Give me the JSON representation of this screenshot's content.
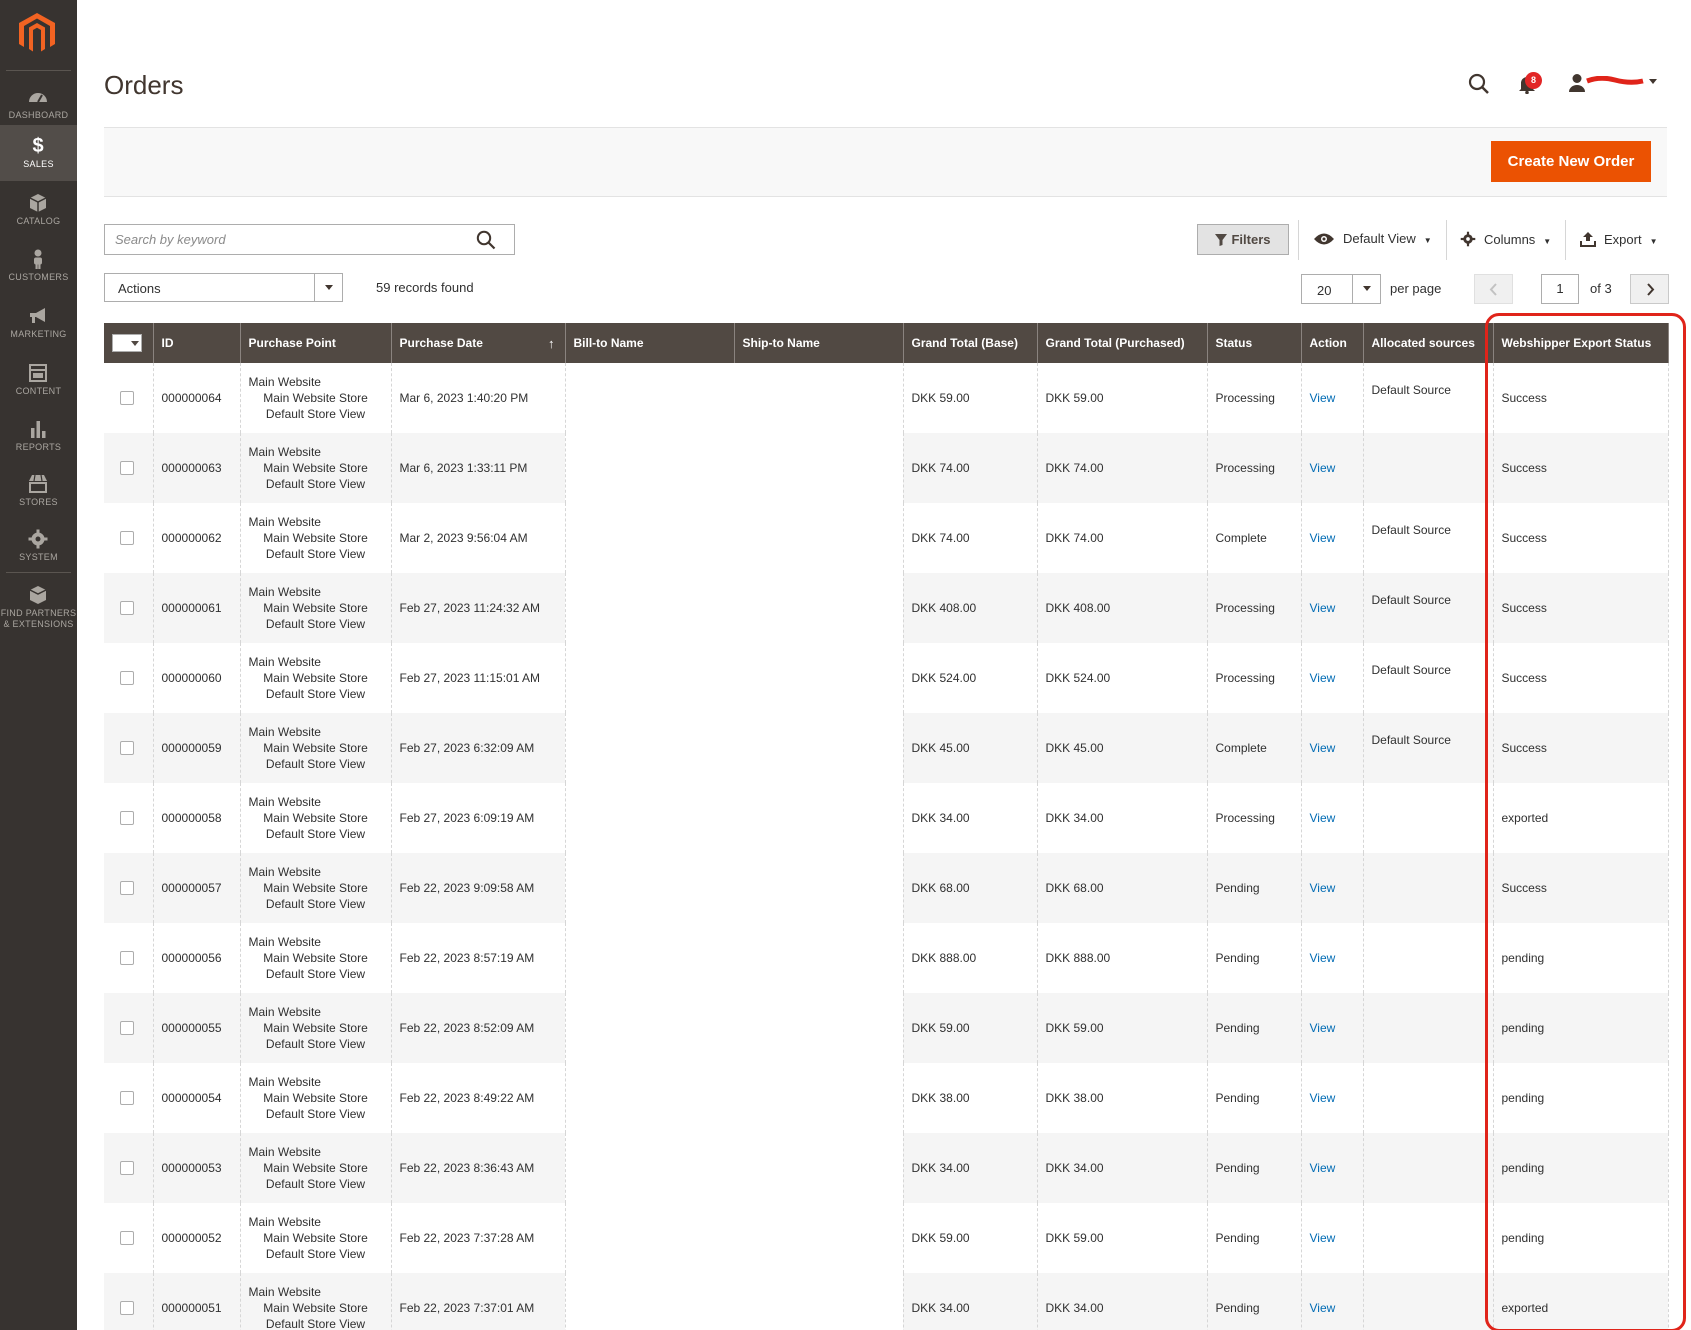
{
  "sidebar": {
    "items": [
      {
        "label": "DASHBOARD",
        "icon": "dashboard-icon"
      },
      {
        "label": "SALES",
        "icon": "dollar-icon",
        "active": true
      },
      {
        "label": "CATALOG",
        "icon": "cube-icon"
      },
      {
        "label": "CUSTOMERS",
        "icon": "person-icon"
      },
      {
        "label": "MARKETING",
        "icon": "megaphone-icon"
      },
      {
        "label": "CONTENT",
        "icon": "content-icon"
      },
      {
        "label": "REPORTS",
        "icon": "bar-chart-icon"
      },
      {
        "label": "STORES",
        "icon": "store-icon"
      },
      {
        "label": "SYSTEM",
        "icon": "gear-icon"
      }
    ],
    "partners_line1": "FIND PARTNERS",
    "partners_line2": "& EXTENSIONS"
  },
  "header": {
    "title": "Orders",
    "notification_count": "8"
  },
  "action_bar": {
    "create_label": "Create New Order"
  },
  "toolbar": {
    "search_placeholder": "Search by keyword",
    "filters_label": "Filters",
    "view_label": "Default View",
    "columns_label": "Columns",
    "export_label": "Export",
    "actions_label": "Actions",
    "records_found": "59 records found",
    "per_page_value": "20",
    "per_page_label": "per page",
    "page_value": "1",
    "page_of": "of 3"
  },
  "table": {
    "headers": {
      "id": "ID",
      "purchase_point": "Purchase Point",
      "purchase_date": "Purchase Date",
      "bill_to": "Bill-to Name",
      "ship_to": "Ship-to Name",
      "grand_total_base": "Grand Total (Base)",
      "grand_total_purchased": "Grand Total (Purchased)",
      "status": "Status",
      "action": "Action",
      "allocated_sources": "Allocated sources",
      "webshipper_status": "Webshipper Export Status"
    },
    "rows": [
      {
        "id": "000000064",
        "pp1": "Main Website",
        "pp2": "Main Website Store",
        "pp3": "Default Store View",
        "date": "Mar 6, 2023 1:40:20 PM",
        "gt_base": "DKK 59.00",
        "gt_purchased": "DKK 59.00",
        "status": "Processing",
        "action": "View",
        "source": "Default Source",
        "ws_status": "Success"
      },
      {
        "id": "000000063",
        "pp1": "Main Website",
        "pp2": "Main Website Store",
        "pp3": "Default Store View",
        "date": "Mar 6, 2023 1:33:11 PM",
        "gt_base": "DKK 74.00",
        "gt_purchased": "DKK 74.00",
        "status": "Processing",
        "action": "View",
        "source": "",
        "ws_status": "Success"
      },
      {
        "id": "000000062",
        "pp1": "Main Website",
        "pp2": "Main Website Store",
        "pp3": "Default Store View",
        "date": "Mar 2, 2023 9:56:04 AM",
        "gt_base": "DKK 74.00",
        "gt_purchased": "DKK 74.00",
        "status": "Complete",
        "action": "View",
        "source": "Default Source",
        "ws_status": "Success"
      },
      {
        "id": "000000061",
        "pp1": "Main Website",
        "pp2": "Main Website Store",
        "pp3": "Default Store View",
        "date": "Feb 27, 2023 11:24:32 AM",
        "gt_base": "DKK 408.00",
        "gt_purchased": "DKK 408.00",
        "status": "Processing",
        "action": "View",
        "source": "Default Source",
        "ws_status": "Success"
      },
      {
        "id": "000000060",
        "pp1": "Main Website",
        "pp2": "Main Website Store",
        "pp3": "Default Store View",
        "date": "Feb 27, 2023 11:15:01 AM",
        "gt_base": "DKK 524.00",
        "gt_purchased": "DKK 524.00",
        "status": "Processing",
        "action": "View",
        "source": "Default Source",
        "ws_status": "Success"
      },
      {
        "id": "000000059",
        "pp1": "Main Website",
        "pp2": "Main Website Store",
        "pp3": "Default Store View",
        "date": "Feb 27, 2023 6:32:09 AM",
        "gt_base": "DKK 45.00",
        "gt_purchased": "DKK 45.00",
        "status": "Complete",
        "action": "View",
        "source": "Default Source",
        "ws_status": "Success"
      },
      {
        "id": "000000058",
        "pp1": "Main Website",
        "pp2": "Main Website Store",
        "pp3": "Default Store View",
        "date": "Feb 27, 2023 6:09:19 AM",
        "gt_base": "DKK 34.00",
        "gt_purchased": "DKK 34.00",
        "status": "Processing",
        "action": "View",
        "source": "",
        "ws_status": "exported"
      },
      {
        "id": "000000057",
        "pp1": "Main Website",
        "pp2": "Main Website Store",
        "pp3": "Default Store View",
        "date": "Feb 22, 2023 9:09:58 AM",
        "gt_base": "DKK 68.00",
        "gt_purchased": "DKK 68.00",
        "status": "Pending",
        "action": "View",
        "source": "",
        "ws_status": "Success"
      },
      {
        "id": "000000056",
        "pp1": "Main Website",
        "pp2": "Main Website Store",
        "pp3": "Default Store View",
        "date": "Feb 22, 2023 8:57:19 AM",
        "gt_base": "DKK 888.00",
        "gt_purchased": "DKK 888.00",
        "status": "Pending",
        "action": "View",
        "source": "",
        "ws_status": "pending"
      },
      {
        "id": "000000055",
        "pp1": "Main Website",
        "pp2": "Main Website Store",
        "pp3": "Default Store View",
        "date": "Feb 22, 2023 8:52:09 AM",
        "gt_base": "DKK 59.00",
        "gt_purchased": "DKK 59.00",
        "status": "Pending",
        "action": "View",
        "source": "",
        "ws_status": "pending"
      },
      {
        "id": "000000054",
        "pp1": "Main Website",
        "pp2": "Main Website Store",
        "pp3": "Default Store View",
        "date": "Feb 22, 2023 8:49:22 AM",
        "gt_base": "DKK 38.00",
        "gt_purchased": "DKK 38.00",
        "status": "Pending",
        "action": "View",
        "source": "",
        "ws_status": "pending"
      },
      {
        "id": "000000053",
        "pp1": "Main Website",
        "pp2": "Main Website Store",
        "pp3": "Default Store View",
        "date": "Feb 22, 2023 8:36:43 AM",
        "gt_base": "DKK 34.00",
        "gt_purchased": "DKK 34.00",
        "status": "Pending",
        "action": "View",
        "source": "",
        "ws_status": "pending"
      },
      {
        "id": "000000052",
        "pp1": "Main Website",
        "pp2": "Main Website Store",
        "pp3": "Default Store View",
        "date": "Feb 22, 2023 7:37:28 AM",
        "gt_base": "DKK 59.00",
        "gt_purchased": "DKK 59.00",
        "status": "Pending",
        "action": "View",
        "source": "",
        "ws_status": "pending"
      },
      {
        "id": "000000051",
        "pp1": "Main Website",
        "pp2": "Main Website Store",
        "pp3": "Default Store View",
        "date": "Feb 22, 2023 7:37:01 AM",
        "gt_base": "DKK 34.00",
        "gt_purchased": "DKK 34.00",
        "status": "Pending",
        "action": "View",
        "source": "",
        "ws_status": "exported"
      }
    ]
  },
  "colors": {
    "sidebar_bg": "#373330",
    "header_row_bg": "#514943",
    "accent_orange": "#eb5202",
    "link_blue": "#006bb4",
    "highlight_red": "#e0241a"
  }
}
